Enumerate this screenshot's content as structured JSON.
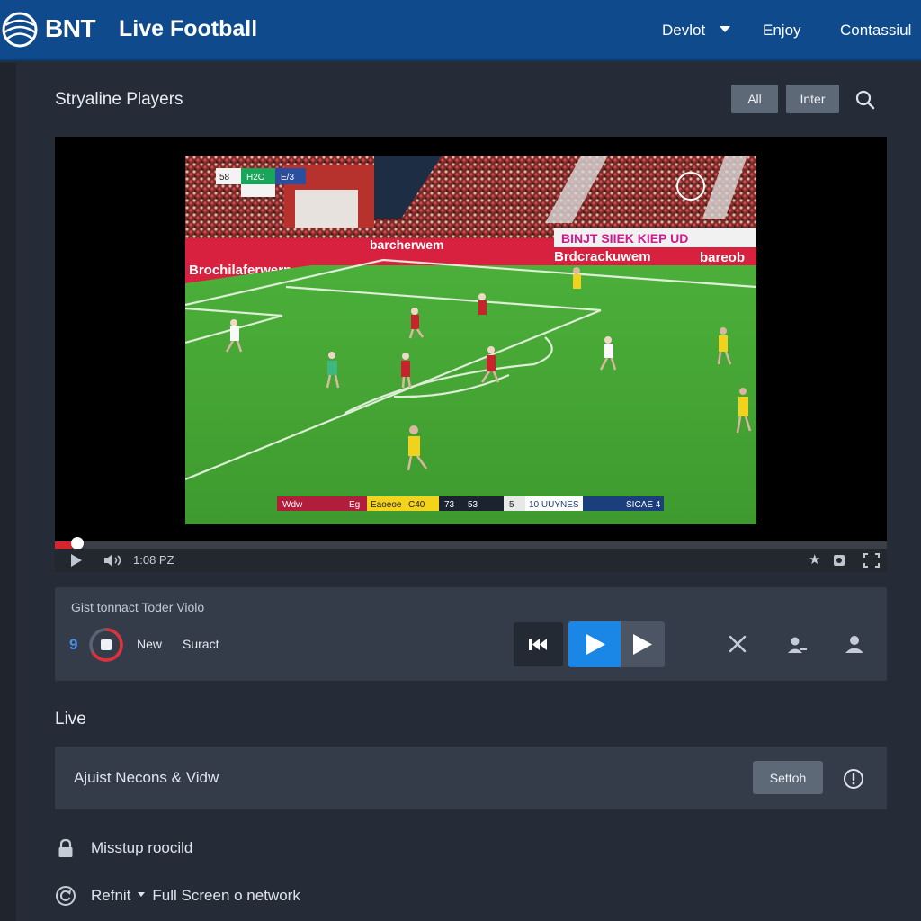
{
  "header": {
    "brand": "BNT",
    "brand_sub": "Live Football",
    "nav": {
      "devlot": "Devlot",
      "enjoy": "Enjoy",
      "contact": "Contassiul"
    }
  },
  "section": {
    "title": "Stryaline Players",
    "filters": {
      "all": "All",
      "inter": "Inter"
    }
  },
  "player": {
    "scoreboard_top": [
      "58",
      "H2O",
      "E/3"
    ],
    "sponsor_left": "Brochilaferwern",
    "sponsor_mid": "barcherwem",
    "sponsor_right_top": "BINJT SIIEK KIEP UD",
    "sponsor_right": "Brdcrackuwem",
    "sponsor_far_right": "bareob",
    "bottom_score": [
      "Wdw",
      "Eg",
      "Eaoeoe",
      "C40",
      "73",
      "53",
      "5",
      "10 UUYNES",
      "SICAE 4"
    ],
    "progress": 0.02,
    "time": "1:08 PZ",
    "colors": {
      "progress": "#d6252f",
      "pitch": "#4caf3a",
      "home": "#c8232c",
      "away": "#f2d21c"
    }
  },
  "control_panel": {
    "title": "Gist tonnact Toder Violo",
    "count": "9",
    "new_label": "New",
    "surract_label": "Suract",
    "accent": "#1a86e6"
  },
  "live": {
    "heading": "Live",
    "card_label": "Ajuist Necons & Vidw",
    "switch_label": "Settoh",
    "options": [
      {
        "icon": "lock-icon",
        "text": "Misstup roocild"
      },
      {
        "icon": "refresh-icon",
        "text": "Refnit",
        "text2": "Full Screen o network"
      }
    ]
  }
}
